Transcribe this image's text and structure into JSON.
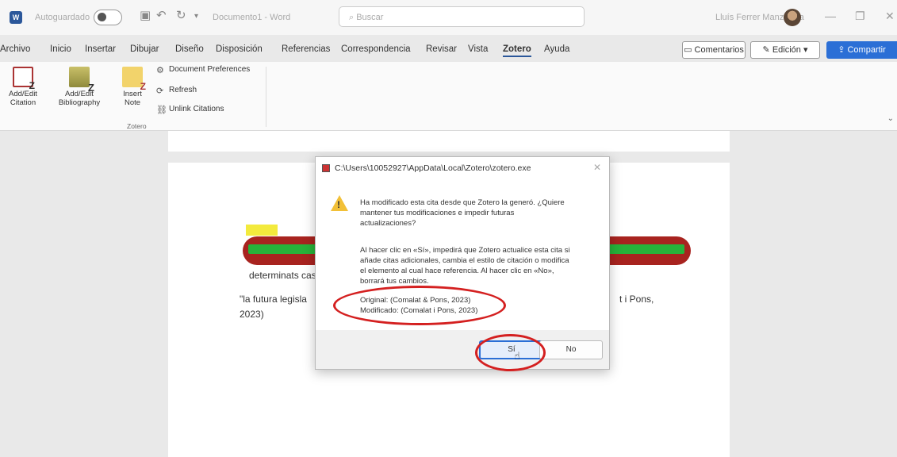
{
  "titlebar": {
    "autosave_label": "Autoguardado",
    "doc_name": "Documento1 - Word",
    "search_placeholder": "Buscar",
    "user_name": "Lluís Ferrer Manzanilla"
  },
  "tabs": [
    "Archivo",
    "Inicio",
    "Insertar",
    "Dibujar",
    "Diseño",
    "Disposición",
    "Referencias",
    "Correspondencia",
    "Revisar",
    "Vista",
    "Zotero",
    "Ayuda"
  ],
  "active_tab": "Zotero",
  "header_buttons": {
    "comments": "Comentarios",
    "edit": "Edición",
    "share": "Compartir"
  },
  "ribbon": {
    "add_edit_citation": [
      "Add/Edit",
      "Citation"
    ],
    "add_edit_bibliography": [
      "Add/Edit",
      "Bibliography"
    ],
    "insert_note": [
      "Insert",
      "Note"
    ],
    "document_preferences": "Document Preferences",
    "refresh": "Refresh",
    "unlink_citations": "Unlink Citations",
    "group_label": "Zotero"
  },
  "document": {
    "line1": "determinats cas",
    "line2_start": "\"la futura legisla",
    "line2_end": "t i Pons,",
    "line3": "2023)"
  },
  "dialog": {
    "title": "C:\\Users\\10052927\\AppData\\Local\\Zotero\\zotero.exe",
    "message_lines": [
      "Ha modificado esta cita desde que Zotero la generó. ¿Quiere",
      "mantener tus modificaciones e impedir futuras",
      "actualizaciones?"
    ],
    "info_lines": [
      "Al hacer clic en «Sí», impedirá que Zotero actualice esta cita si",
      "añade citas adicionales, cambia el estilo de citación o modifica",
      "el elemento al cual hace referencia. Al hacer clic en «No»,",
      "borrará tus cambios."
    ],
    "original": "Original: (Comalat & Pons, 2023)",
    "modified": "Modificado: (Comalat i Pons, 2023)",
    "yes_button": "Sí",
    "no_button": "No"
  },
  "colors": {
    "accent": "#2b6fd6",
    "annotation_red": "#d42020",
    "warning_yellow": "#f2c037"
  }
}
